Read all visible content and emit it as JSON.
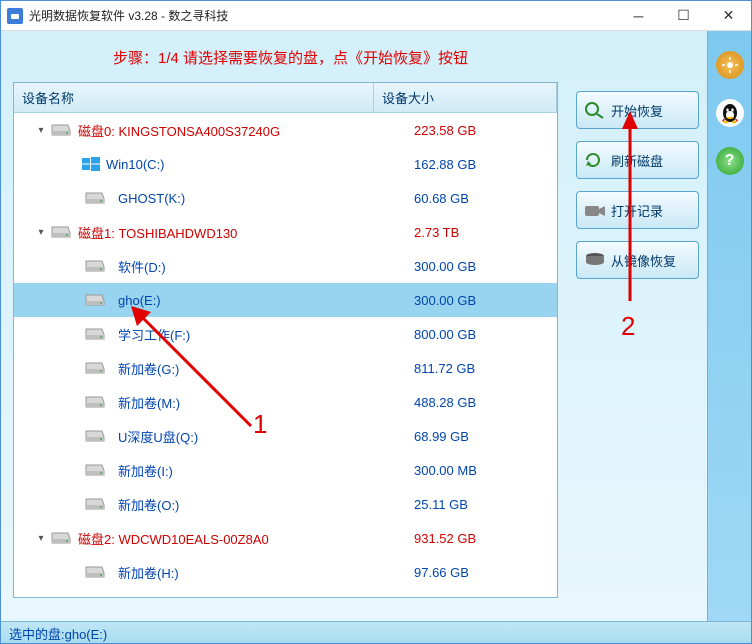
{
  "titlebar": {
    "text": "光明数据恢复软件 v3.28 - 数之寻科技"
  },
  "step_text": "步骤：1/4 请选择需要恢复的盘，点《开始恢复》按钮",
  "columns": {
    "name": "设备名称",
    "size": "设备大小"
  },
  "rows": [
    {
      "type": "disk",
      "expanded": true,
      "label": "磁盘0: KINGSTONSA400S37240G",
      "size": "223.58 GB"
    },
    {
      "type": "part",
      "icon": "win",
      "label": "Win10(C:)",
      "size": "162.88 GB"
    },
    {
      "type": "part",
      "label": "GHOST(K:)",
      "size": "60.68 GB"
    },
    {
      "type": "disk",
      "expanded": true,
      "label": "磁盘1: TOSHIBAHDWD130",
      "size": "2.73 TB"
    },
    {
      "type": "part",
      "label": "软件(D:)",
      "size": "300.00 GB"
    },
    {
      "type": "part",
      "selected": true,
      "label": "gho(E:)",
      "size": "300.00 GB"
    },
    {
      "type": "part",
      "label": "学习工作(F:)",
      "size": "800.00 GB"
    },
    {
      "type": "part",
      "label": "新加卷(G:)",
      "size": "811.72 GB"
    },
    {
      "type": "part",
      "label": "新加卷(M:)",
      "size": "488.28 GB"
    },
    {
      "type": "part",
      "label": "U深度U盘(Q:)",
      "size": "68.99 GB"
    },
    {
      "type": "part",
      "label": "新加卷(I:)",
      "size": "300.00 MB"
    },
    {
      "type": "part",
      "label": "新加卷(O:)",
      "size": "25.11 GB"
    },
    {
      "type": "disk",
      "expanded": true,
      "label": "磁盘2: WDCWD10EALS-00Z8A0",
      "size": "931.52 GB"
    },
    {
      "type": "part",
      "label": "新加卷(H:)",
      "size": "97.66 GB"
    }
  ],
  "buttons": {
    "start": "开始恢复",
    "refresh": "刷新磁盘",
    "openlog": "打开记录",
    "fromimg": "从镜像恢复"
  },
  "statusbar": "选中的盘:gho(E:)",
  "annotations": {
    "label1": "1",
    "label2": "2"
  }
}
